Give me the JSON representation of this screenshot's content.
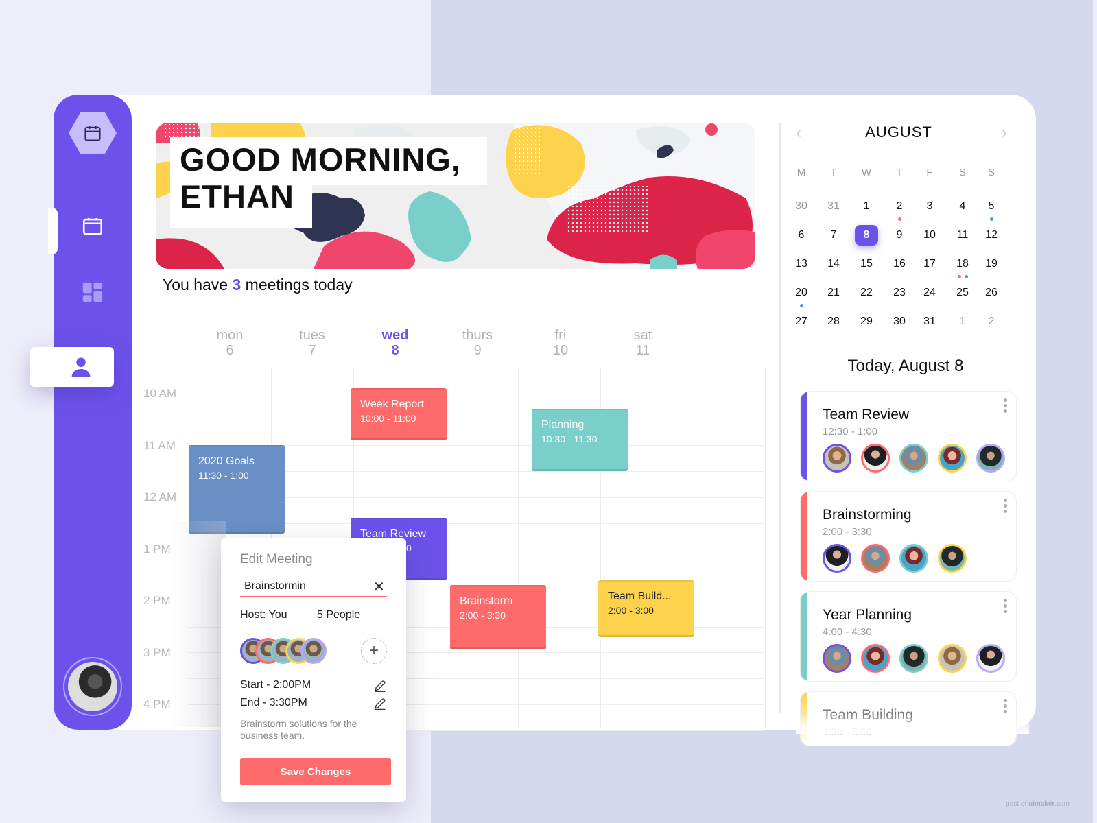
{
  "app": {
    "greeting_line1": "GOOD MORNING,",
    "greeting_line2": "ETHAN",
    "meetings_prefix": "You have ",
    "meetings_count": "3",
    "meetings_suffix": " meetings today",
    "watermark_prefix": "post of ",
    "watermark_brand": "uimaker",
    "watermark_suffix": ".com",
    "colors": {
      "brand": "#6c52ea",
      "coral": "#ff6b6b",
      "teal": "#7acfcb",
      "blue": "#6a8fc4",
      "yellow": "#fdd34d",
      "light_purple": "#b6a8fa"
    }
  },
  "sidebar": {
    "items": [
      {
        "name": "logo",
        "icon": "calendar-icon"
      },
      {
        "name": "calendar",
        "icon": "calendar-icon",
        "active": true
      },
      {
        "name": "dashboard",
        "icon": "dashboard-icon"
      },
      {
        "name": "profile",
        "icon": "user-icon"
      }
    ],
    "avatar": "user-avatar"
  },
  "week": {
    "days": [
      {
        "name": "mon",
        "num": "6",
        "today": false
      },
      {
        "name": "tues",
        "num": "7",
        "today": false
      },
      {
        "name": "wed",
        "num": "8",
        "today": true
      },
      {
        "name": "thurs",
        "num": "9",
        "today": false
      },
      {
        "name": "fri",
        "num": "10",
        "today": false
      },
      {
        "name": "sat",
        "num": "11",
        "today": false
      }
    ],
    "times": [
      "10 AM",
      "11 AM",
      "12 AM",
      "1 PM",
      "2 PM",
      "3 PM",
      "4 PM"
    ],
    "events": [
      {
        "title": "Week Report",
        "time": "10:00 - 11:00",
        "day": 2,
        "start": 10.0,
        "end": 11.0,
        "color": "#ff6b6b",
        "dark": false
      },
      {
        "title": "Planning",
        "time": "10:30 - 11:30",
        "day": 4,
        "start": 10.4,
        "end": 11.6,
        "color": "#7acfcb",
        "dark": false
      },
      {
        "title": "2020 Goals",
        "time": "11:30 - 1:00",
        "day": 0,
        "start": 11.1,
        "end": 12.8,
        "color": "#6a8fc4",
        "dark": false
      },
      {
        "title": "Team Review",
        "time": "12:30 - 1:30",
        "day": 2,
        "start": 12.5,
        "end": 13.7,
        "color": "#6c52ea",
        "dark": false
      },
      {
        "title": "Brainstorm",
        "time": "2:00 - 3:30",
        "day": 3,
        "start": 13.8,
        "end": 15.05,
        "color": "#ff6b6b",
        "dark": false
      },
      {
        "title": "Team Build...",
        "time": "2:00 - 3:00",
        "day": 5,
        "start": 13.7,
        "end": 14.8,
        "color": "#fdd34d",
        "dark": true
      }
    ]
  },
  "edit_meeting": {
    "title": "Edit Meeting",
    "name_value": "Brainstormin",
    "host_label": "Host: You",
    "people_label": "5 People",
    "participant_colors": [
      "#6c52ea",
      "#ff6b6b",
      "#7acfcb",
      "#fdd34d",
      "#b6a8fa"
    ],
    "start_label": "Start - 2:00PM",
    "end_label": "End - 3:30PM",
    "description": "Brainstorm solutions for the business team.",
    "save_label": "Save Changes"
  },
  "calendar": {
    "month": "AUGUST",
    "weekdays": [
      "M",
      "T",
      "W",
      "T",
      "F",
      "S",
      "S"
    ],
    "weeks": [
      [
        {
          "d": "30",
          "m": true
        },
        {
          "d": "31",
          "m": true
        },
        {
          "d": "1"
        },
        {
          "d": "2",
          "dots": [
            "#ff6b6b"
          ]
        },
        {
          "d": "3"
        },
        {
          "d": "4"
        },
        {
          "d": "5",
          "dots": [
            "#3d9cf0"
          ]
        }
      ],
      [
        {
          "d": "6"
        },
        {
          "d": "7"
        },
        {
          "d": "8",
          "sel": true
        },
        {
          "d": "9"
        },
        {
          "d": "10"
        },
        {
          "d": "11"
        },
        {
          "d": "12"
        }
      ],
      [
        {
          "d": "13"
        },
        {
          "d": "14"
        },
        {
          "d": "15"
        },
        {
          "d": "16"
        },
        {
          "d": "17"
        },
        {
          "d": "18",
          "dots": [
            "#ff6b6b",
            "#3d9cf0"
          ]
        },
        {
          "d": "19"
        }
      ],
      [
        {
          "d": "20",
          "dots": [
            "#3d9cf0"
          ]
        },
        {
          "d": "21"
        },
        {
          "d": "22"
        },
        {
          "d": "23"
        },
        {
          "d": "24"
        },
        {
          "d": "25"
        },
        {
          "d": "26"
        }
      ],
      [
        {
          "d": "27"
        },
        {
          "d": "28"
        },
        {
          "d": "29"
        },
        {
          "d": "30"
        },
        {
          "d": "31"
        },
        {
          "d": "1",
          "m": true
        },
        {
          "d": "2",
          "m": true
        }
      ]
    ]
  },
  "today": {
    "title": "Today, August 8",
    "meetings": [
      {
        "title": "Team Review",
        "time": "12:30 - 1:00",
        "accent": "#6c52ea",
        "avatars": [
          "#6c52ea",
          "#ff6b6b",
          "#7acfcb",
          "#fdd34d",
          "#b6a8fa"
        ]
      },
      {
        "title": "Brainstorming",
        "time": "2:00 - 3:30",
        "accent": "#ff6b6b",
        "avatars": [
          "#6c52ea",
          "#ff6b6b",
          "#7acfcb",
          "#fdd34d"
        ]
      },
      {
        "title": "Year Planning",
        "time": "4:00 - 4:30",
        "accent": "#7acfcb",
        "avatars": [
          "#6c52ea",
          "#ff6b6b",
          "#7acfcb",
          "#fdd34d",
          "#b6a8fa"
        ]
      },
      {
        "title": "Team Building",
        "time": "4:30 - 5:00",
        "accent": "#fdd34d",
        "avatars": []
      }
    ]
  }
}
